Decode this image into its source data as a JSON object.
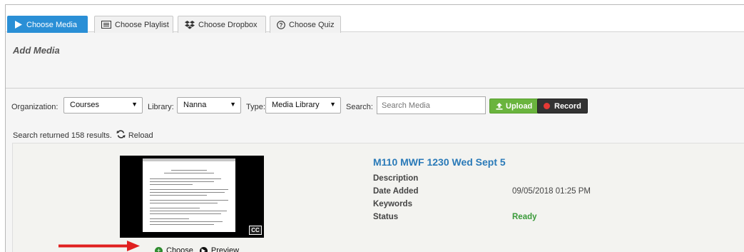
{
  "tabs": [
    {
      "label": "Choose Media",
      "icon": "play-icon",
      "active": true
    },
    {
      "label": "Choose Playlist",
      "icon": "playlist-icon"
    },
    {
      "label": "Choose Dropbox",
      "icon": "dropbox-icon"
    },
    {
      "label": "Choose Quiz",
      "icon": "question-icon"
    }
  ],
  "heading": "Add Media",
  "filters": {
    "organization_label": "Organization:",
    "organization_value": "Courses",
    "library_label": "Library:",
    "library_value": "Nanna",
    "type_label": "Type:",
    "type_value": "Media Library",
    "search_label": "Search:",
    "search_placeholder": "Search Media",
    "upload_label": "Upload",
    "record_label": "Record"
  },
  "results": {
    "summary": "Search returned 158 results.",
    "reload_label": "Reload"
  },
  "item": {
    "title": "M110 MWF 1230 Wed Sept 5",
    "description_label": "Description",
    "date_label": "Date Added",
    "date_value": "09/05/2018 01:25 PM",
    "keywords_label": "Keywords",
    "status_label": "Status",
    "status_value": "Ready",
    "choose_label": "Choose",
    "preview_label": "Preview",
    "cc_label": "CC"
  },
  "colors": {
    "accent": "#2a8fd6",
    "upload": "#6ab43e",
    "record": "#333333",
    "ready": "#3a9a3a",
    "annotation_arrow": "#e02020"
  }
}
